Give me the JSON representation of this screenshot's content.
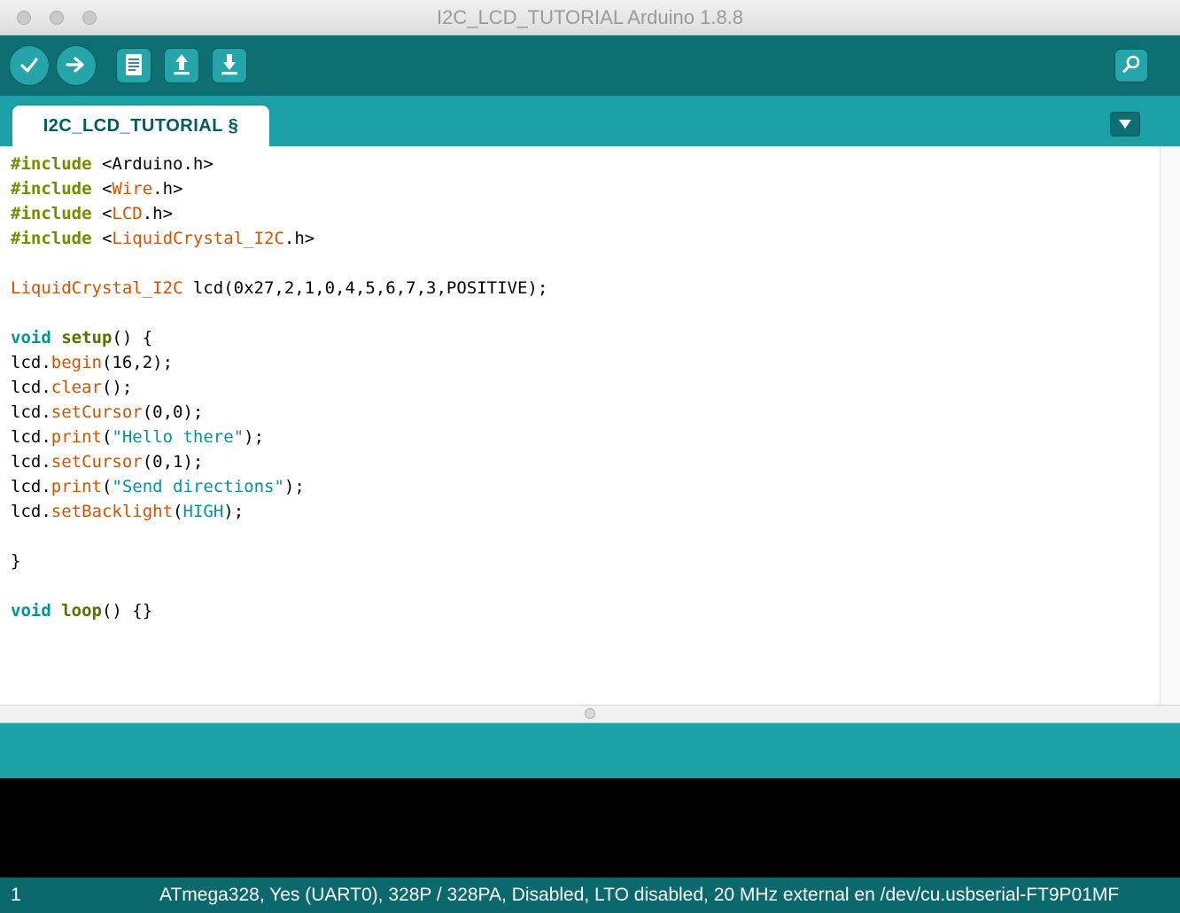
{
  "window": {
    "title": "I2C_LCD_TUTORIAL Arduino 1.8.8"
  },
  "toolbar": {
    "icons": {
      "verify": "check-icon",
      "upload": "right-arrow-icon",
      "new": "new-sketch-document-icon",
      "open": "up-arrow-icon",
      "save": "down-arrow-icon",
      "serial_monitor": "magnifier-icon"
    }
  },
  "tab": {
    "label": "I2C_LCD_TUTORIAL §"
  },
  "editor": {
    "lines": [
      [
        [
          "pre",
          "#include"
        ],
        [
          "pln",
          " <Arduino.h>"
        ]
      ],
      [
        [
          "pre",
          "#include"
        ],
        [
          "pln",
          " <"
        ],
        [
          "lib",
          "Wire"
        ],
        [
          "pln",
          ".h>"
        ]
      ],
      [
        [
          "pre",
          "#include"
        ],
        [
          "pln",
          " <"
        ],
        [
          "lib",
          "LCD"
        ],
        [
          "pln",
          ".h>"
        ]
      ],
      [
        [
          "pre",
          "#include"
        ],
        [
          "pln",
          " <"
        ],
        [
          "lib",
          "LiquidCrystal_I2C"
        ],
        [
          "pln",
          ".h>"
        ]
      ],
      [],
      [
        [
          "lib",
          "LiquidCrystal_I2C"
        ],
        [
          "pln",
          " lcd(0x27,2,1,0,4,5,6,7,3,POSITIVE);"
        ]
      ],
      [],
      [
        [
          "kw",
          "void"
        ],
        [
          "pln",
          " "
        ],
        [
          "fn2",
          "setup"
        ],
        [
          "pln",
          "() {"
        ]
      ],
      [
        [
          "pln",
          "lcd."
        ],
        [
          "fn",
          "begin"
        ],
        [
          "pln",
          "(16,2);"
        ]
      ],
      [
        [
          "pln",
          "lcd."
        ],
        [
          "fn",
          "clear"
        ],
        [
          "pln",
          "();"
        ]
      ],
      [
        [
          "pln",
          "lcd."
        ],
        [
          "fn",
          "setCursor"
        ],
        [
          "pln",
          "(0,0);"
        ]
      ],
      [
        [
          "pln",
          "lcd."
        ],
        [
          "fn",
          "print"
        ],
        [
          "pln",
          "("
        ],
        [
          "str",
          "\"Hello there\""
        ],
        [
          "pln",
          ");"
        ]
      ],
      [
        [
          "pln",
          "lcd."
        ],
        [
          "fn",
          "setCursor"
        ],
        [
          "pln",
          "(0,1);"
        ]
      ],
      [
        [
          "pln",
          "lcd."
        ],
        [
          "fn",
          "print"
        ],
        [
          "pln",
          "("
        ],
        [
          "str",
          "\"Send directions\""
        ],
        [
          "pln",
          ");"
        ]
      ],
      [
        [
          "pln",
          "lcd."
        ],
        [
          "fn",
          "setBacklight"
        ],
        [
          "pln",
          "("
        ],
        [
          "lit",
          "HIGH"
        ],
        [
          "pln",
          ");"
        ]
      ],
      [],
      [
        [
          "pln",
          "}"
        ]
      ],
      [],
      [
        [
          "kw",
          "void"
        ],
        [
          "pln",
          " "
        ],
        [
          "fn2",
          "loop"
        ],
        [
          "pln",
          "() {}"
        ]
      ]
    ]
  },
  "console": {
    "text": ""
  },
  "status_bar": {
    "line_number": "1",
    "board_info": "ATmega328, Yes (UART0), 328P / 328PA, Disabled, LTO disabled, 20 MHz external en /dev/cu.usbserial-FT9P01MF"
  },
  "colors": {
    "toolbar_bg": "#0E6F73",
    "tab_strip_bg": "#1CA1A6",
    "button_bg": "#25A4A9",
    "status_bar_bg": "#0B686C",
    "console_bg": "#000000",
    "tab_text": "#015C60",
    "syntax": {
      "pre": "#728E00",
      "kw": "#00979C",
      "fn2": "#5E6D03",
      "fn": "#D35400",
      "lib": "#D35400",
      "str": "#00979C",
      "lit": "#00979C",
      "pln": "#000000"
    }
  }
}
